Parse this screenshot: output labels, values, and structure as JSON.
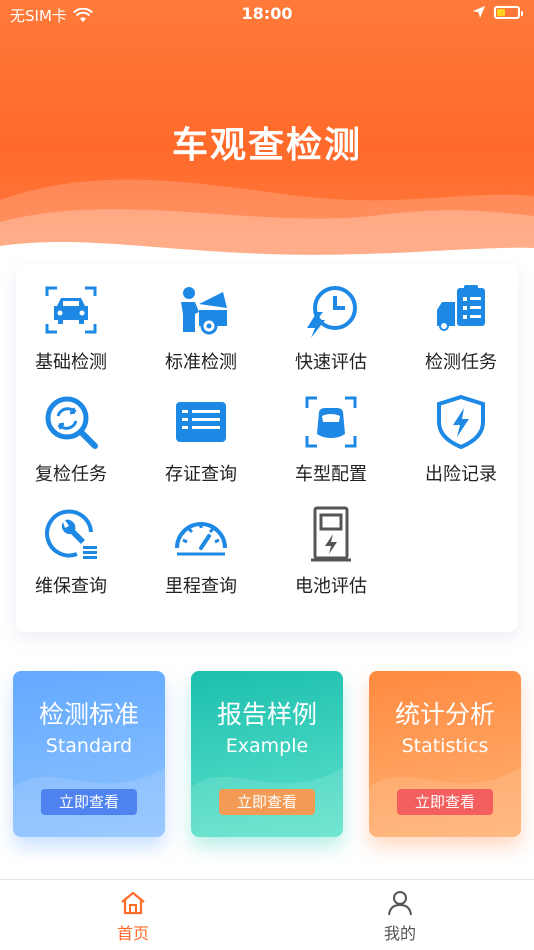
{
  "status_bar": {
    "carrier": "无SIM卡",
    "time": "18:00"
  },
  "header": {
    "title": "车观查检测"
  },
  "grid": [
    {
      "label": "基础检测",
      "icon": "car-scan-icon"
    },
    {
      "label": "标准检测",
      "icon": "mechanic-icon"
    },
    {
      "label": "快速评估",
      "icon": "fast-clock-icon"
    },
    {
      "label": "检测任务",
      "icon": "truck-task-icon"
    },
    {
      "label": "复检任务",
      "icon": "recheck-search-icon"
    },
    {
      "label": "存证查询",
      "icon": "certificate-icon"
    },
    {
      "label": "车型配置",
      "icon": "car-model-icon"
    },
    {
      "label": "出险记录",
      "icon": "shield-bolt-icon"
    },
    {
      "label": "维保查询",
      "icon": "wrench-icon"
    },
    {
      "label": "里程查询",
      "icon": "speedometer-icon"
    },
    {
      "label": "电池评估",
      "icon": "charging-station-icon"
    }
  ],
  "features": [
    {
      "title": "检测标准",
      "subtitle": "Standard",
      "button": "立即查看"
    },
    {
      "title": "报告样例",
      "subtitle": "Example",
      "button": "立即查看"
    },
    {
      "title": "统计分析",
      "subtitle": "Statistics",
      "button": "立即查看"
    }
  ],
  "tabs": {
    "home": "首页",
    "me": "我的"
  },
  "colors": {
    "brand": "#ff6b2a",
    "icon_blue": "#1e88e5"
  }
}
